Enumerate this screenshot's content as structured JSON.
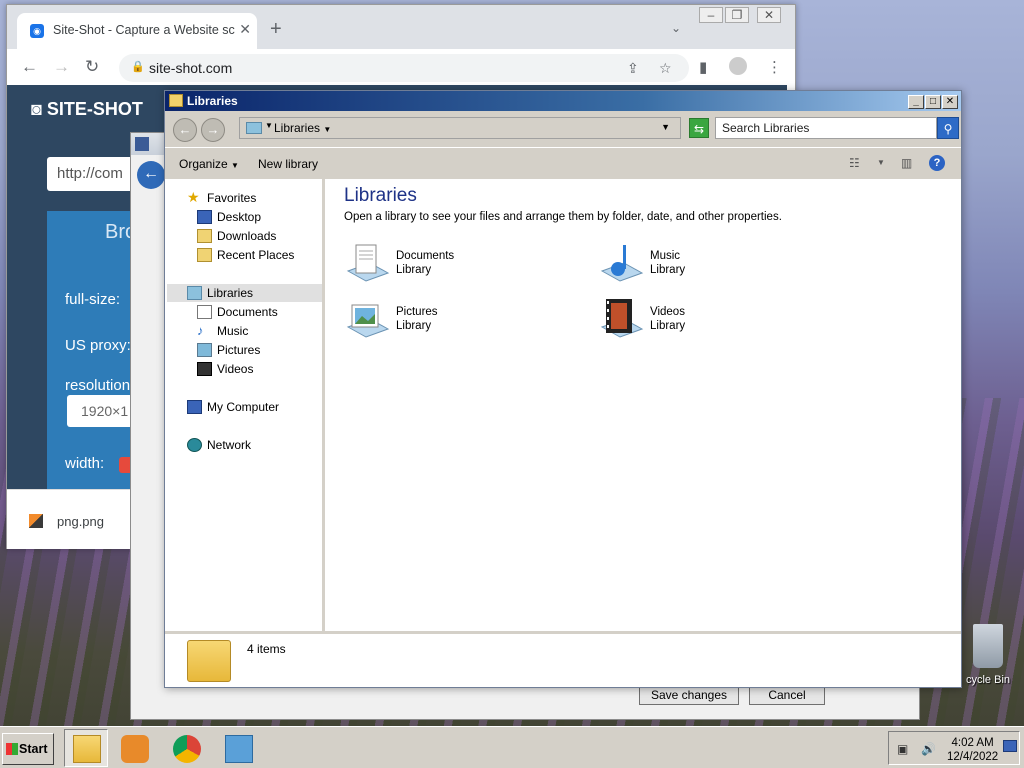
{
  "chrome": {
    "tab_title": "Site-Shot - Capture a Website sc",
    "url": "site-shot.com",
    "site": {
      "logo": "SITE-SHOT",
      "url_placeholder": "http://com",
      "browse": "Bro",
      "full_size_label": "full-size:",
      "proxy_label": "US proxy:",
      "resolution_label": "resolution",
      "resolution_value": "1920×1",
      "width_label": "width:"
    },
    "download": {
      "filename": "png.png"
    }
  },
  "dialog": {
    "save_label": "Save changes",
    "cancel_label": "Cancel"
  },
  "explorer": {
    "title": "Libraries",
    "address": "Libraries",
    "search_placeholder": "Search Libraries",
    "toolbar": {
      "organize": "Organize",
      "new_library": "New library"
    },
    "nav": {
      "favorites": "Favorites",
      "desktop": "Desktop",
      "downloads": "Downloads",
      "recent": "Recent Places",
      "libraries": "Libraries",
      "documents": "Documents",
      "music": "Music",
      "pictures": "Pictures",
      "videos": "Videos",
      "computer": "My Computer",
      "network": "Network"
    },
    "heading": "Libraries",
    "subtitle": "Open a library to see your files and arrange them by folder, date, and other properties.",
    "libraries": [
      {
        "name": "Documents",
        "type": "Library"
      },
      {
        "name": "Music",
        "type": "Library"
      },
      {
        "name": "Pictures",
        "type": "Library"
      },
      {
        "name": "Videos",
        "type": "Library"
      }
    ],
    "status": "4 items"
  },
  "desktop": {
    "recycle_bin": "cycle Bin"
  },
  "taskbar": {
    "start": "Start",
    "time": "4:02 AM",
    "date": "12/4/2022"
  }
}
